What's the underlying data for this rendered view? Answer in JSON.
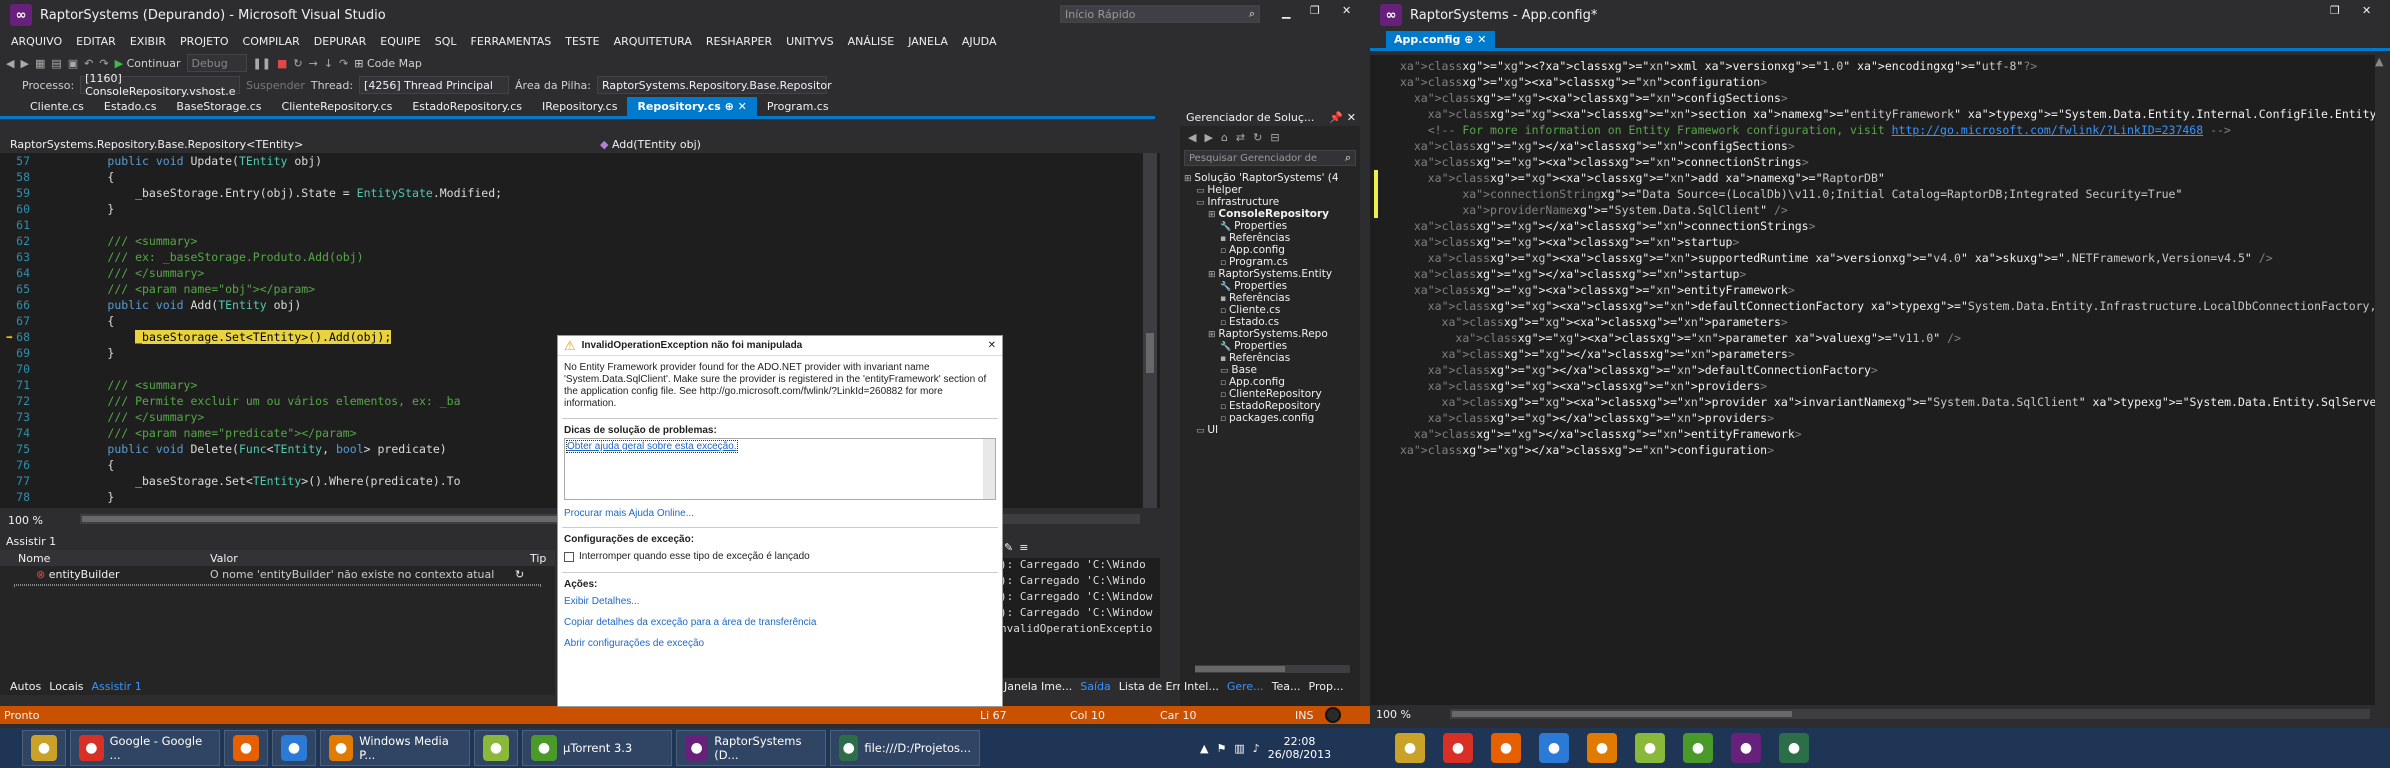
{
  "left_window": {
    "title": "RaptorSystems (Depurando) - Microsoft Visual Studio",
    "quick_launch": "Início Rápido",
    "menu": [
      "ARQUIVO",
      "EDITAR",
      "EXIBIR",
      "PROJETO",
      "COMPILAR",
      "DEPURAR",
      "EQUIPE",
      "SQL",
      "FERRAMENTAS",
      "TESTE",
      "ARQUITETURA",
      "RESHARPER",
      "UNITYVS",
      "ANÁLISE",
      "JANELA",
      "AJUDA"
    ],
    "toolbar": {
      "continue": "Continuar",
      "config": "Debug",
      "code_map": "Code Map"
    },
    "debug_bar": {
      "process_label": "Processo:",
      "process": "[1160] ConsoleRepository.vshost.e",
      "suspend": "Suspender",
      "thread_label": "Thread:",
      "thread": "[4256] Thread Principal",
      "stack_label": "Área da Pilha:",
      "stack": "RaptorSystems.Repository.Base.Repositor"
    },
    "tabs": [
      "Cliente.cs",
      "Estado.cs",
      "BaseStorage.cs",
      "ClienteRepository.cs",
      "EstadoRepository.cs",
      "IRepository.cs",
      "Repository.cs",
      "Program.cs"
    ],
    "nav": {
      "left": "RaptorSystems.Repository.Base.Repository<TEntity>",
      "right": "Add(TEntity obj)"
    },
    "zoom": "100 %",
    "watch": {
      "title": "Assistir 1",
      "col_name": "Nome",
      "col_value": "Valor",
      "col_type": "Tip",
      "row_name": "entityBuilder",
      "row_value": "O nome 'entityBuilder' não existe no contexto atual"
    },
    "bottom_tabs": [
      "Autos",
      "Locais",
      "Assistir 1"
    ],
    "output_lines": [
      "): Carregado 'C:\\Windo",
      "): Carregado 'C:\\Windo",
      "): Carregado 'C:\\Window",
      "): Carregado 'C:\\Window",
      "nvalidOperationExceptio"
    ],
    "output_tabs": [
      "Janela Ime...",
      "Saída",
      "Lista de Err..."
    ],
    "status": {
      "ready": "Pronto",
      "ln": "Li 67",
      "col": "Col 10",
      "car": "Car 10",
      "ins": "INS"
    },
    "solution": {
      "title": "Gerenciador de Soluç...",
      "search": "Pesquisar Gerenciador de",
      "items": [
        "Solução 'RaptorSystems' (4",
        "Helper",
        "Infrastructure",
        "ConsoleRepository",
        "Properties",
        "Referências",
        "App.config",
        "Program.cs",
        "RaptorSystems.Entity",
        "Properties",
        "Referências",
        "Cliente.cs",
        "Estado.cs",
        "RaptorSystems.Repo",
        "Properties",
        "Referências",
        "Base",
        "App.config",
        "ClienteRepository",
        "EstadoRepository",
        "packages.config",
        "UI"
      ],
      "bottom_tabs": [
        "Intel...",
        "Gere...",
        "Tea...",
        "Prop..."
      ]
    }
  },
  "code": [
    {
      "n": "57",
      "t": "        public void Update(TEntity obj)"
    },
    {
      "n": "58",
      "t": "        {"
    },
    {
      "n": "59",
      "t": "            _baseStorage.Entry(obj).State = EntityState.Modified;"
    },
    {
      "n": "60",
      "t": "        }"
    },
    {
      "n": "61",
      "t": ""
    },
    {
      "n": "62",
      "t": "        /// <summary>"
    },
    {
      "n": "63",
      "t": "        /// ex: _baseStorage.Produto.Add(obj)"
    },
    {
      "n": "64",
      "t": "        /// </summary>"
    },
    {
      "n": "65",
      "t": "        /// <param name=\"obj\"></param>"
    },
    {
      "n": "66",
      "t": "        public void Add(TEntity obj)"
    },
    {
      "n": "67",
      "t": "        {"
    },
    {
      "n": "68",
      "t": "            _baseStorage.Set<TEntity>().Add(obj);"
    },
    {
      "n": "69",
      "t": "        }"
    },
    {
      "n": "70",
      "t": ""
    },
    {
      "n": "71",
      "t": "        /// <summary>"
    },
    {
      "n": "72",
      "t": "        /// Permite excluir um ou vários elementos, ex: _ba"
    },
    {
      "n": "73",
      "t": "        /// </summary>"
    },
    {
      "n": "74",
      "t": "        /// <param name=\"predicate\"></param>"
    },
    {
      "n": "75",
      "t": "        public void Delete(Func<TEntity, bool> predicate)"
    },
    {
      "n": "76",
      "t": "        {"
    },
    {
      "n": "77",
      "t": "            _baseStorage.Set<TEntity>().Where(predicate).To"
    },
    {
      "n": "78",
      "t": "        }"
    }
  ],
  "code_tail_77": "));",
  "exception": {
    "title": "InvalidOperationException não foi manipulada",
    "message": "No Entity Framework provider found for the ADO.NET provider with invariant name 'System.Data.SqlClient'. Make sure the provider is registered in the 'entityFramework' section of the application config file. See http://go.microsoft.com/fwlink/?LinkId=260882 for more information.",
    "tips_title": "Dicas de solução de problemas:",
    "tips_link": "Obter ajuda geral sobre esta exceção.",
    "more_help": "Procurar mais Ajuda Online...",
    "settings_title": "Configurações de exceção:",
    "checkbox": "Interromper quando esse tipo de exceção é lançado",
    "actions_title": "Ações:",
    "actions": [
      "Exibir Detalhes...",
      "Copiar detalhes da exceção para a área de transferência",
      "Abrir configurações de exceção"
    ]
  },
  "right_window": {
    "title": "RaptorSystems - App.config*",
    "tab": "App.config",
    "zoom": "100 %"
  },
  "xml": [
    "<?xml version=\"1.0\" encoding=\"utf-8\"?>",
    "<configuration>",
    "  <configSections>",
    "    <section name=\"entityFramework\" type=\"System.Data.Entity.Internal.ConfigFile.EntityFrameworkSection, EntityFramewo",
    "    <!-- For more information on Entity Framework configuration, visit http://go.microsoft.com/fwlink/?LinkID=237468 -->",
    "  </configSections>",
    "  <connectionStrings>",
    "    <add name=\"RaptorDB\"",
    "         connectionString=\"Data Source=(LocalDb)\\v11.0;Initial Catalog=RaptorDB;Integrated Security=True\"",
    "         providerName=\"System.Data.SqlClient\" />",
    "  </connectionStrings>",
    "  <startup>",
    "    <supportedRuntime version=\"v4.0\" sku=\".NETFramework,Version=v4.5\" />",
    "  </startup>",
    "  <entityFramework>",
    "    <defaultConnectionFactory type=\"System.Data.Entity.Infrastructure.LocalDbConnectionFactory, EntityFramework\">",
    "      <parameters>",
    "        <parameter value=\"v11.0\" />",
    "      </parameters>",
    "    </defaultConnectionFactory>",
    "    <providers>",
    "      <provider invariantName=\"System.Data.SqlClient\" type=\"System.Data.Entity.SqlServer.SqlProviderServices, EntityFr",
    "    </providers>",
    "  </entityFramework>",
    "</configuration>"
  ],
  "taskbar": {
    "left": [
      {
        "label": "",
        "icon": "explorer-icon",
        "color": "#c9a227"
      },
      {
        "label": "Google - Google ...",
        "icon": "chrome-icon",
        "color": "#d93025"
      },
      {
        "label": "",
        "icon": "firefox-icon",
        "color": "#e66000"
      },
      {
        "label": "",
        "icon": "app-icon",
        "color": "#2a7ad6"
      },
      {
        "label": "Windows Media P...",
        "icon": "media-player-icon",
        "color": "#e07b00"
      },
      {
        "label": "",
        "icon": "notepad-icon",
        "color": "#8ab83a"
      },
      {
        "label": "µTorrent 3.3",
        "icon": "utorrent-icon",
        "color": "#4a9a2a"
      },
      {
        "label": "RaptorSystems (D...",
        "icon": "visual-studio-icon",
        "color": "#68217a"
      },
      {
        "label": "file:///D:/Projetos...",
        "icon": "window-icon",
        "color": "#2c6e48"
      }
    ],
    "time": "22:08",
    "date": "26/08/2013",
    "right": [
      {
        "icon": "explorer-icon",
        "color": "#c9a227"
      },
      {
        "icon": "chrome-icon",
        "color": "#d93025"
      },
      {
        "icon": "firefox-icon",
        "color": "#e66000"
      },
      {
        "icon": "app-icon",
        "color": "#2a7ad6"
      },
      {
        "icon": "media-player-icon",
        "color": "#e07b00"
      },
      {
        "icon": "notepad-icon",
        "color": "#8ab83a"
      },
      {
        "icon": "utorrent-icon",
        "color": "#4a9a2a"
      },
      {
        "icon": "visual-studio-icon",
        "color": "#68217a"
      },
      {
        "icon": "window-icon",
        "color": "#2c6e48"
      }
    ]
  }
}
